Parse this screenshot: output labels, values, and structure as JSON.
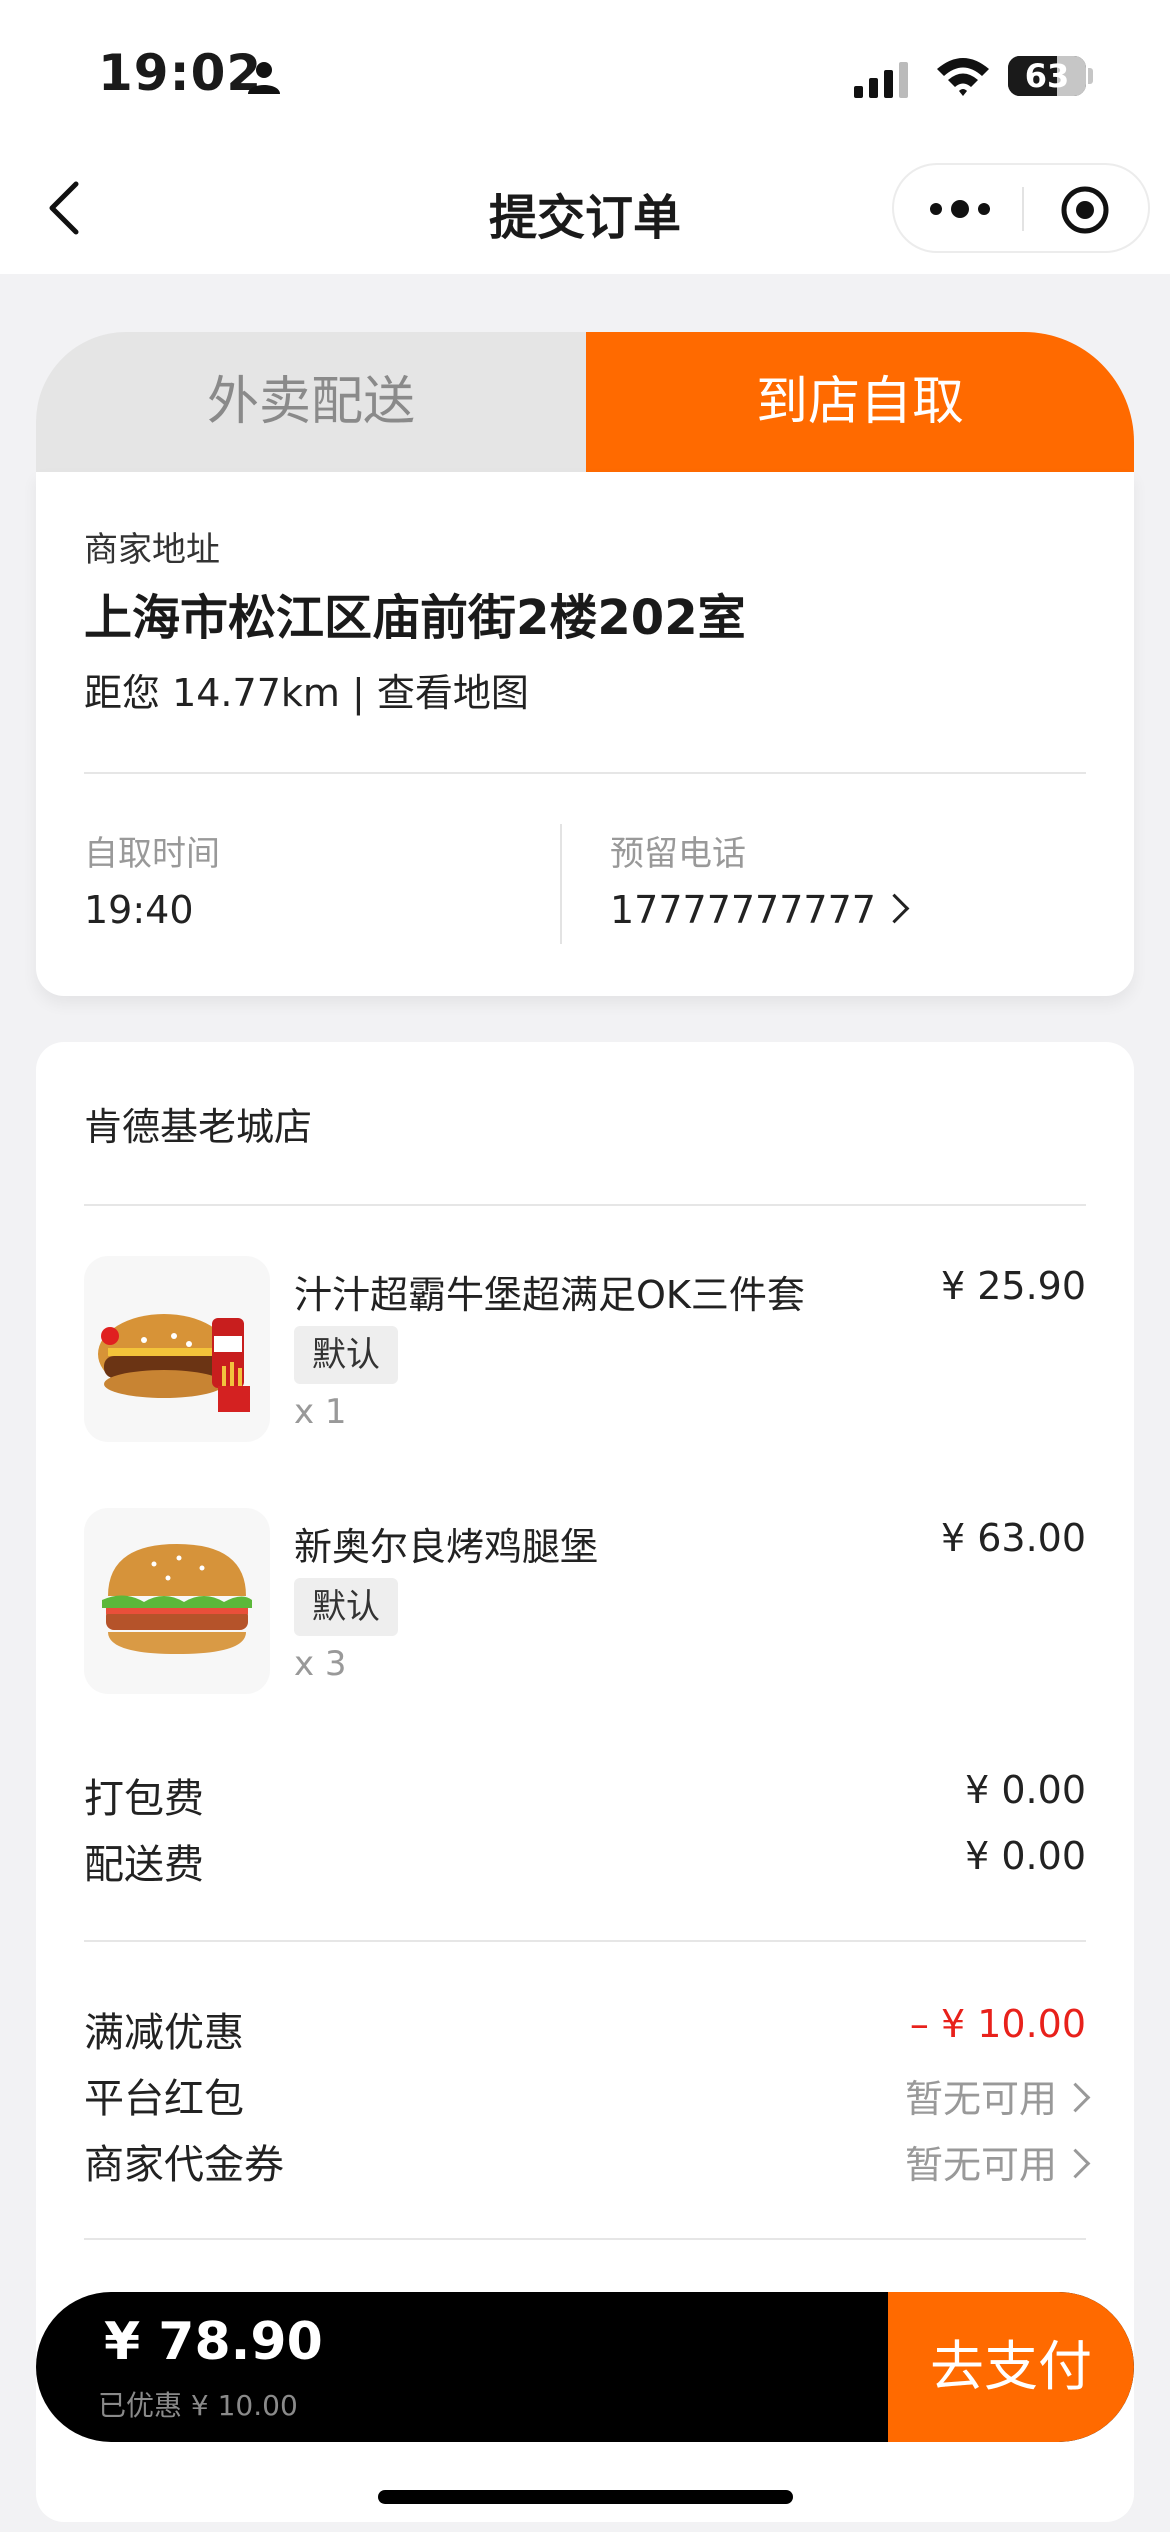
{
  "status_bar": {
    "time": "19:02",
    "battery": "63"
  },
  "nav": {
    "title": "提交订单"
  },
  "tabs": {
    "delivery": "外卖配送",
    "pickup": "到店自取",
    "active": "pickup"
  },
  "pickup_info": {
    "address_label": "商家地址",
    "address": "上海市松江区庙前街2楼202室",
    "distance": "距您 14.77km | 查看地图",
    "time_label": "自取时间",
    "time_value": "19:40",
    "phone_label": "预留电话",
    "phone_value": "17777777777"
  },
  "store": {
    "name": "肯德基老城店"
  },
  "items": [
    {
      "name": "汁汁超霸牛堡超满足OK三件套",
      "spec": "默认",
      "qty": "x 1",
      "price": "¥ 25.90"
    },
    {
      "name": "新奥尔良烤鸡腿堡",
      "spec": "默认",
      "qty": "x 3",
      "price": "¥ 63.00"
    }
  ],
  "fees": {
    "packing_label": "打包费",
    "packing_value": "¥ 0.00",
    "delivery_label": "配送费",
    "delivery_value": "¥ 0.00"
  },
  "discounts": {
    "full_reduction_label": "满减优惠",
    "full_reduction_value": "– ¥ 10.00",
    "platform_label": "平台红包",
    "platform_value": "暂无可用",
    "voucher_label": "商家代金券",
    "voucher_value": "暂无可用"
  },
  "pay_bar": {
    "total": "¥ 78.90",
    "saved": "已优惠 ¥ 10.00",
    "pay_label": "去支付"
  },
  "colors": {
    "accent": "#ff6a00",
    "discount_red": "#e8211b"
  }
}
